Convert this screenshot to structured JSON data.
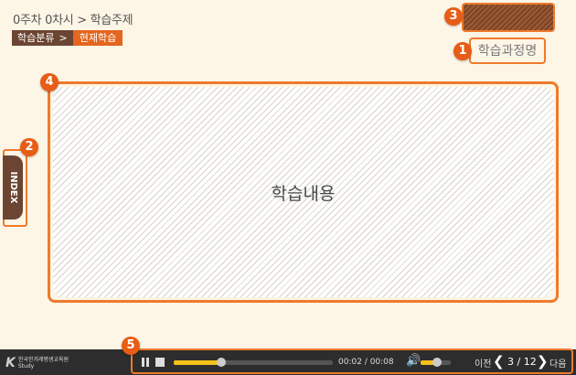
{
  "header": {
    "title": "0주차 0차시 > 학습주제",
    "crumb_primary": "학습분류",
    "crumb_sep": ">",
    "crumb_current": "현재학습"
  },
  "course_name": "학습과정명",
  "content": {
    "label": "학습내용"
  },
  "index_tab": {
    "label": "INDEX"
  },
  "badges": [
    "1",
    "2",
    "3",
    "4",
    "5"
  ],
  "player": {
    "logo_mark": "K",
    "logo_org": "한국한겨레평생교육원",
    "logo_sub": "Study",
    "time": "00:02 / 00:08",
    "progress": 0.3,
    "volume": 0.55,
    "prev_label": "이전",
    "next_label": "다음",
    "page": "3 / 12"
  },
  "colors": {
    "accent": "#ef7a2c",
    "brown": "#6b4532",
    "orange": "#e4661f",
    "background": "#fdf5e6",
    "bar": "#2d2d2d",
    "progress": "#f4c21a"
  },
  "icons": [
    "pause-icon",
    "stop-icon",
    "volume-icon",
    "chevron-left-icon",
    "chevron-right-icon"
  ]
}
